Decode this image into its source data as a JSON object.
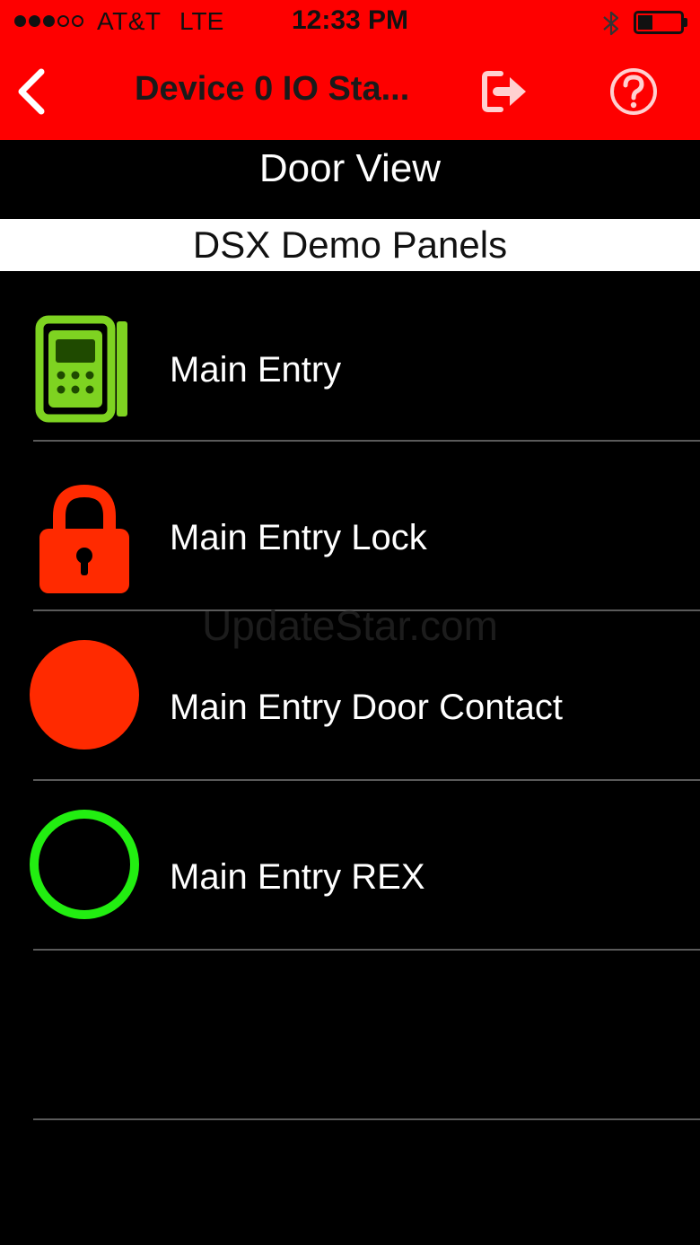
{
  "status_bar": {
    "signal_bars_filled": 3,
    "signal_bars_total": 5,
    "carrier": "AT&T",
    "network": "LTE",
    "time": "12:33 PM",
    "bluetooth_icon": "bluetooth-icon",
    "battery_level": 0.35
  },
  "nav": {
    "title": "Device 0 IO Sta...",
    "back_icon": "chevron-left-icon",
    "logout_icon": "logout-icon",
    "help_icon": "help-circle-icon",
    "bar_color": "#fe0000"
  },
  "section_title": "Door View",
  "group_name": "DSX Demo Panels",
  "items": [
    {
      "label": "Main Entry",
      "icon": "card-reader-icon",
      "icon_color": "#7ed321"
    },
    {
      "label": "Main Entry Lock",
      "icon": "padlock-icon",
      "icon_color": "#ff2a00"
    },
    {
      "label": "Main Entry Door Contact",
      "icon": "filled-circle-icon",
      "icon_color": "#ff2a00"
    },
    {
      "label": "Main Entry REX",
      "icon": "ring-circle-icon",
      "icon_color": "#22ee11"
    }
  ],
  "watermark": "UpdateStar.com"
}
